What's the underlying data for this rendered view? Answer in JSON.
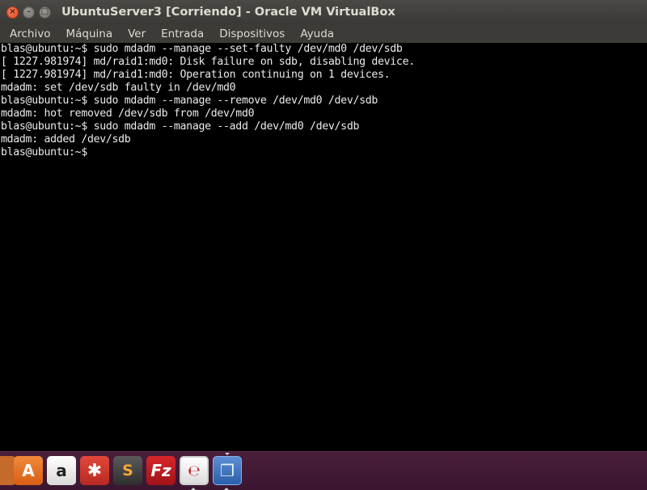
{
  "window": {
    "title": "UbuntuServer3 [Corriendo] - Oracle VM VirtualBox",
    "controls": {
      "close": "×",
      "minimize": "–",
      "maximize": "□"
    }
  },
  "menu": {
    "items": [
      {
        "label": "Archivo"
      },
      {
        "label": "Máquina"
      },
      {
        "label": "Ver"
      },
      {
        "label": "Entrada"
      },
      {
        "label": "Dispositivos"
      },
      {
        "label": "Ayuda"
      }
    ]
  },
  "terminal": {
    "lines": [
      "blas@ubuntu:~$ sudo mdadm --manage --set-faulty /dev/md0 /dev/sdb",
      "[ 1227.981974] md/raid1:md0: Disk failure on sdb, disabling device.",
      "[ 1227.981974] md/raid1:md0: Operation continuing on 1 devices.",
      "mdadm: set /dev/sdb faulty in /dev/md0",
      "blas@ubuntu:~$ sudo mdadm --manage --remove /dev/md0 /dev/sdb",
      "mdadm: hot removed /dev/sdb from /dev/md0",
      "blas@ubuntu:~$ sudo mdadm --manage --add /dev/md0 /dev/sdb",
      "mdadm: added /dev/sdb",
      "blas@ubuntu:~$"
    ]
  },
  "dock": {
    "items": [
      {
        "name": "files-icon",
        "glyph": ""
      },
      {
        "name": "software-center-icon",
        "glyph": "A"
      },
      {
        "name": "amazon-icon",
        "glyph": "a"
      },
      {
        "name": "system-settings-icon",
        "glyph": "✱"
      },
      {
        "name": "sublime-text-icon",
        "glyph": "S"
      },
      {
        "name": "filezilla-icon",
        "glyph": "Fz"
      },
      {
        "name": "document-viewer-icon",
        "glyph": "℮"
      },
      {
        "name": "virtualbox-icon",
        "glyph": "❒"
      }
    ],
    "colors": {
      "background": "#4a1f3c",
      "accent": "#e0471f"
    }
  }
}
